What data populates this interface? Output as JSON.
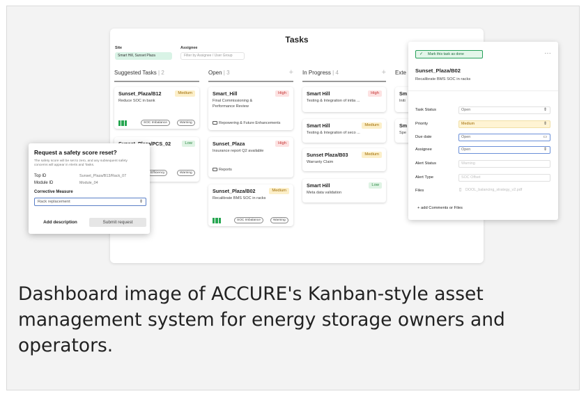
{
  "board": {
    "title": "Tasks",
    "site_label": "Site",
    "site_value": "Smart Hill, Sunset Plaza",
    "assignee_label": "Assignee",
    "assignee_placeholder": "Filter by Assignee / User Group"
  },
  "columns": [
    {
      "name": "Suggested Tasks",
      "sep": " | ",
      "count": "2"
    },
    {
      "name": "Open",
      "sep": " | ",
      "count": "3",
      "add": "+"
    },
    {
      "name": "In Progress",
      "sep": " | ",
      "count": "4",
      "add": "+"
    },
    {
      "name": "Exte"
    }
  ],
  "suggested": [
    {
      "title": "Sunset_Plaza/B12",
      "priority": "Medium",
      "desc": "Reduce SOC in bank",
      "tags": [
        "SOC Imbalance",
        "Warning"
      ]
    },
    {
      "title": "Sunset_Plaza/PCS_02",
      "priority": "Low",
      "desc": "point",
      "tags": [
        "Efficiency",
        "Warning"
      ]
    }
  ],
  "open": [
    {
      "title": "Smart_Hill",
      "priority": "High",
      "desc": "Final Commissioning & Performance Review",
      "folder": "Repowering & Future Enhancements"
    },
    {
      "title": "Sunset_Plaza",
      "priority": "High",
      "desc": "Insurance report Q2 available",
      "folder": "Reports"
    },
    {
      "title": "Sunset_Plaza/B02",
      "priority": "Medium",
      "desc": "Recalibrate BMS SOC in racks",
      "tags": [
        "SOC Imbalance",
        "Warning"
      ]
    }
  ],
  "in_progress": [
    {
      "title": "Smart Hill",
      "priority": "High",
      "desc": "Testing & Integration of initia ..."
    },
    {
      "title": "Smart Hill",
      "priority": "Medium",
      "desc": "Testing & Integration of seco ..."
    },
    {
      "title": "Sunset Plaza/B03",
      "priority": "Medium",
      "desc": "Warranty Claim"
    },
    {
      "title": "Smart Hill",
      "priority": "Low",
      "desc": "Meta data validation"
    }
  ],
  "external_partial": [
    {
      "title": "Sm",
      "desc": "Initi"
    },
    {
      "title": "Sm",
      "desc": "Spe"
    }
  ],
  "dialog": {
    "title": "Request a safety score reset?",
    "description": "The safety score will be set to zero, and any subsequent safety concerns will appear in Alerts and Tasks.",
    "top_id_label": "Top ID",
    "top_id_value": "Sunset_Plaza/B13/Rack_07",
    "module_id_label": "Module ID",
    "module_id_value": "Module_04",
    "corrective_label": "Corrective Measure",
    "corrective_value": "Rack replacement",
    "add_description": "Add description",
    "submit": "Submit request"
  },
  "side_panel": {
    "done_button": "Mark this task as done",
    "more": "···",
    "title": "Sunset_Plaza/B02",
    "subtitle": "Recalibrate BMS SOC in racks",
    "rows": [
      {
        "label": "Task Status",
        "value": "Open"
      },
      {
        "label": "Priority",
        "value": "Medium"
      },
      {
        "label": "Due date",
        "value": "Open"
      },
      {
        "label": "Assignee",
        "value": "Open"
      },
      {
        "label": "Alert Status",
        "value": "Warning"
      },
      {
        "label": "Alert Type",
        "value": "SOC Offset"
      },
      {
        "label": "Files",
        "value": "DOOL_balancing_strategy_v2.pdf"
      }
    ],
    "add_comments": "+ add Comments or Files"
  },
  "caption": "Dashboard image of ACCURE's Kanban-style asset management system for energy storage owners and operators.",
  "colors": {
    "green": "#27a651",
    "high": "#c43333",
    "medium": "#a06b00",
    "low": "#2e8b45"
  }
}
